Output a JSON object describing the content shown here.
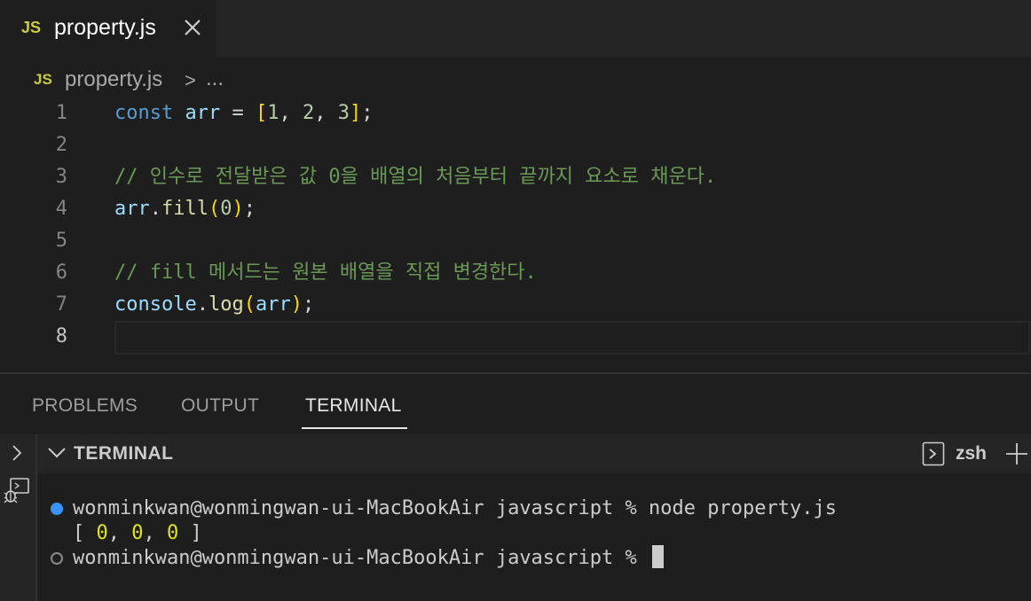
{
  "tab": {
    "badge": "JS",
    "title": "property.js"
  },
  "breadcrumb": {
    "badge": "JS",
    "file": "property.js",
    "separator": ">",
    "more": "..."
  },
  "editor": {
    "lines": [
      {
        "num": "1",
        "tokens": [
          [
            "kw",
            "const"
          ],
          [
            "",
            ""
          ],
          [
            "var",
            " arr"
          ],
          [
            "",
            " = "
          ],
          [
            "br1",
            "["
          ],
          [
            "num",
            "1"
          ],
          [
            "",
            ", "
          ],
          [
            "num",
            "2"
          ],
          [
            "",
            ", "
          ],
          [
            "num",
            "3"
          ],
          [
            "br1",
            "]"
          ],
          [
            "",
            ";"
          ]
        ]
      },
      {
        "num": "2",
        "tokens": []
      },
      {
        "num": "3",
        "tokens": [
          [
            "cmt",
            "// 인수로 전달받은 값 0을 배열의 처음부터 끝까지 요소로 채운다."
          ]
        ]
      },
      {
        "num": "4",
        "tokens": [
          [
            "var",
            "arr"
          ],
          [
            "",
            "."
          ],
          [
            "fn",
            "fill"
          ],
          [
            "br1",
            "("
          ],
          [
            "num",
            "0"
          ],
          [
            "br1",
            ")"
          ],
          [
            "",
            ";"
          ]
        ]
      },
      {
        "num": "5",
        "tokens": []
      },
      {
        "num": "6",
        "tokens": [
          [
            "cmt",
            "// fill 메서드는 원본 배열을 직접 변경한다."
          ]
        ]
      },
      {
        "num": "7",
        "tokens": [
          [
            "var",
            "console"
          ],
          [
            "",
            "."
          ],
          [
            "fn",
            "log"
          ],
          [
            "br1",
            "("
          ],
          [
            "var",
            "arr"
          ],
          [
            "br1",
            ")"
          ],
          [
            "",
            ";"
          ]
        ]
      },
      {
        "num": "8",
        "tokens": []
      }
    ],
    "active_line": "8"
  },
  "panel": {
    "tabs": [
      "PROBLEMS",
      "OUTPUT",
      "TERMINAL"
    ],
    "active_tab": "TERMINAL"
  },
  "terminal": {
    "title": "TERMINAL",
    "shell": "zsh",
    "prompt1": "wonminkwan@wonmingwan-ui-MacBookAir javascript % node property.js",
    "output_open": "[ ",
    "output_values": [
      "0",
      "0",
      "0"
    ],
    "output_sep": ", ",
    "output_close": " ]",
    "prompt2": "wonminkwan@wonmingwan-ui-MacBookAir javascript % "
  },
  "colors": {
    "accent_blue": "#3794ff",
    "js_badge": "#cbcb41",
    "comment": "#6a9955",
    "keyword": "#569cd6"
  }
}
